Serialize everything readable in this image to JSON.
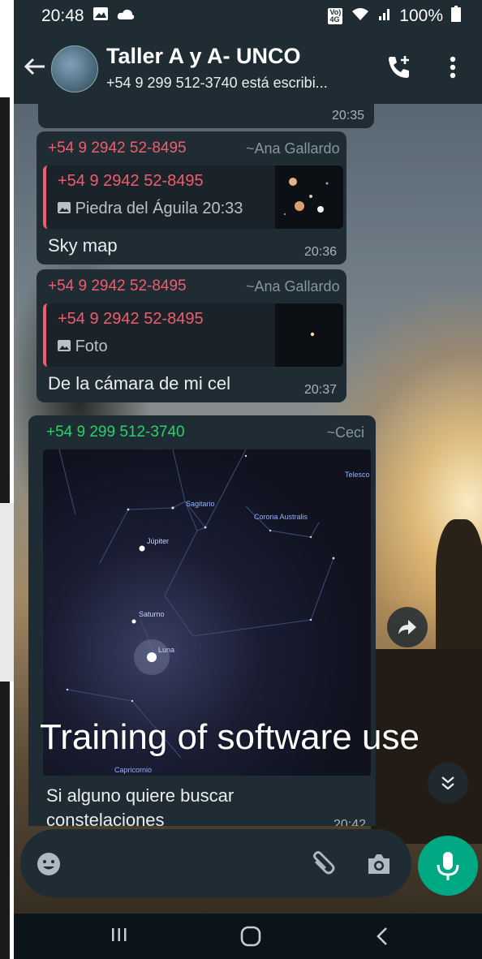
{
  "status_bar": {
    "time": "20:48",
    "battery": "100%",
    "network_badge_top": "Vo)",
    "network_badge_bottom": "4G"
  },
  "header": {
    "title": "Taller A y A- UNCO",
    "subtitle": "+54 9 299 512-3740 está escribi..."
  },
  "messages": [
    {
      "time": "20:35"
    },
    {
      "sender_phone": "+54 9 2942 52-8495",
      "sender_name": "~Ana Gallardo",
      "quote": {
        "name": "+54 9 2942 52-8495",
        "text": "Piedra del Águila 20:33"
      },
      "text": "Sky map",
      "time": "20:36"
    },
    {
      "sender_phone": "+54 9 2942 52-8495",
      "sender_name": "~Ana Gallardo",
      "quote": {
        "name": "+54 9 2942 52-8495",
        "text": "Foto"
      },
      "text": "De la cámara de mi cel",
      "time": "20:37"
    },
    {
      "sender_phone": "+54 9 299 512-3740",
      "sender_name": "~Ceci",
      "sky_labels": {
        "sagitario": "Sagitario",
        "corona": "Corona Australis",
        "jupiter": "Júpiter",
        "saturno": "Saturno",
        "luna": "Luna",
        "capricornio": "Capricornio",
        "telesco": "Telesco"
      },
      "text_line1": "Si alguno quiere buscar",
      "text_line2": "constelaciones",
      "time": "20:42"
    }
  ],
  "overlay": {
    "caption": "Training of software use"
  },
  "colors": {
    "accent": "#00a884",
    "sender_red": "#f15c6d",
    "sender_green": "#25d366"
  }
}
